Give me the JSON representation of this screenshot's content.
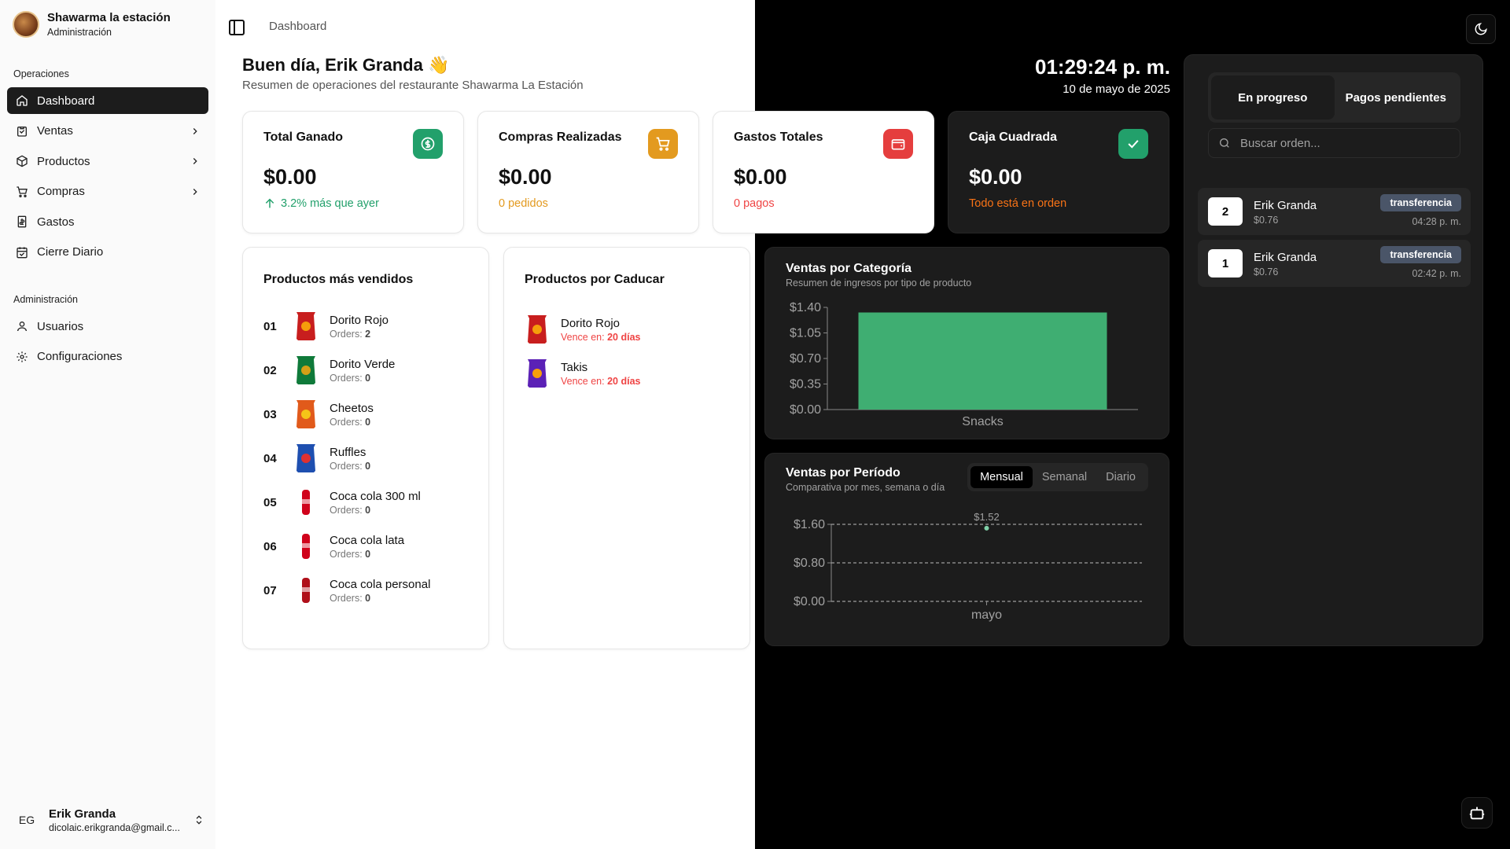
{
  "sidebar": {
    "brand_title": "Shawarma la estación",
    "brand_subtitle": "Administración",
    "section_operations": "Operaciones",
    "section_admin": "Administración",
    "items": [
      {
        "label": "Dashboard",
        "icon": "home-icon"
      },
      {
        "label": "Ventas",
        "icon": "clipboard-icon"
      },
      {
        "label": "Productos",
        "icon": "package-icon"
      },
      {
        "label": "Compras",
        "icon": "cart-icon"
      },
      {
        "label": "Gastos",
        "icon": "receipt-icon"
      },
      {
        "label": "Cierre Diario",
        "icon": "calendar-icon"
      }
    ],
    "admin_items": [
      {
        "label": "Usuarios",
        "icon": "user-icon"
      },
      {
        "label": "Configuraciones",
        "icon": "gear-icon"
      }
    ],
    "user": {
      "initials": "EG",
      "name": "Erik Granda",
      "email": "dicolaic.erikgranda@gmail.c..."
    }
  },
  "header": {
    "breadcrumb": "Dashboard",
    "greeting": "Buen día, Erik Granda 👋",
    "greeting_sub": "Resumen de operaciones del restaurante Shawarma La Estación",
    "clock_time": "01:29:24 p. m.",
    "clock_date": "10 de mayo de 2025"
  },
  "stats": [
    {
      "title": "Total Ganado",
      "value": "$0.00",
      "sub": "3.2% más que ayer",
      "icon": "dollar-icon",
      "color": "#22a06b"
    },
    {
      "title": "Compras Realizadas",
      "value": "$0.00",
      "sub": "0 pedidos",
      "icon": "cart-icon",
      "color": "#e39a1f"
    },
    {
      "title": "Gastos Totales",
      "value": "$0.00",
      "sub": "0 pagos",
      "icon": "wallet-icon",
      "color": "#e53e3e"
    },
    {
      "title": "Caja Cuadrada",
      "value": "$0.00",
      "sub": "Todo está en orden",
      "icon": "check-icon",
      "color": "#22a06b"
    }
  ],
  "top_products": {
    "title": "Productos más vendidos",
    "orders_label": "Orders:",
    "items": [
      {
        "rank": "01",
        "name": "Dorito Rojo",
        "orders": "2"
      },
      {
        "rank": "02",
        "name": "Dorito Verde",
        "orders": "0"
      },
      {
        "rank": "03",
        "name": "Cheetos",
        "orders": "0"
      },
      {
        "rank": "04",
        "name": "Ruffles",
        "orders": "0"
      },
      {
        "rank": "05",
        "name": "Coca cola 300 ml",
        "orders": "0"
      },
      {
        "rank": "06",
        "name": "Coca cola lata",
        "orders": "0"
      },
      {
        "rank": "07",
        "name": "Coca cola personal",
        "orders": "0"
      }
    ]
  },
  "expiring": {
    "title": "Productos por Caducar",
    "expires_label": "Vence en:",
    "items": [
      {
        "name": "Dorito Rojo",
        "days": "20 días"
      },
      {
        "name": "Takis",
        "days": "20 días"
      }
    ]
  },
  "category_chart": {
    "title": "Ventas por Categoría",
    "subtitle": "Resumen de ingresos por tipo de producto"
  },
  "period_chart": {
    "title": "Ventas por Período",
    "subtitle": "Comparativa por mes, semana o día",
    "tabs": [
      "Mensual",
      "Semanal",
      "Diario"
    ],
    "active_tab": "Mensual"
  },
  "chart_data": [
    {
      "type": "bar",
      "categories": [
        "Snacks"
      ],
      "values": [
        1.33
      ],
      "ylim": [
        0,
        1.4
      ],
      "yticks": [
        "$1.40",
        "$1.05",
        "$0.70",
        "$0.35",
        "$0.00"
      ],
      "color": "#3fae72",
      "grid": false
    },
    {
      "type": "line",
      "categories": [
        "mayo"
      ],
      "values": [
        1.52
      ],
      "data_labels": [
        "$1.52"
      ],
      "ylim": [
        0,
        1.6
      ],
      "yticks": [
        "$1.60",
        "$0.80",
        "$0.00"
      ],
      "grid": true,
      "color": "#7fd1a8"
    }
  ],
  "orders": {
    "tabs": [
      "En progreso",
      "Pagos pendientes"
    ],
    "active_tab": "En progreso",
    "search_placeholder": "Buscar orden...",
    "items": [
      {
        "number": "2",
        "name": "Erik Granda",
        "amount": "$0.76",
        "method": "transferencia",
        "time": "04:28 p. m."
      },
      {
        "number": "1",
        "name": "Erik Granda",
        "amount": "$0.76",
        "method": "transferencia",
        "time": "02:42 p. m."
      }
    ]
  }
}
